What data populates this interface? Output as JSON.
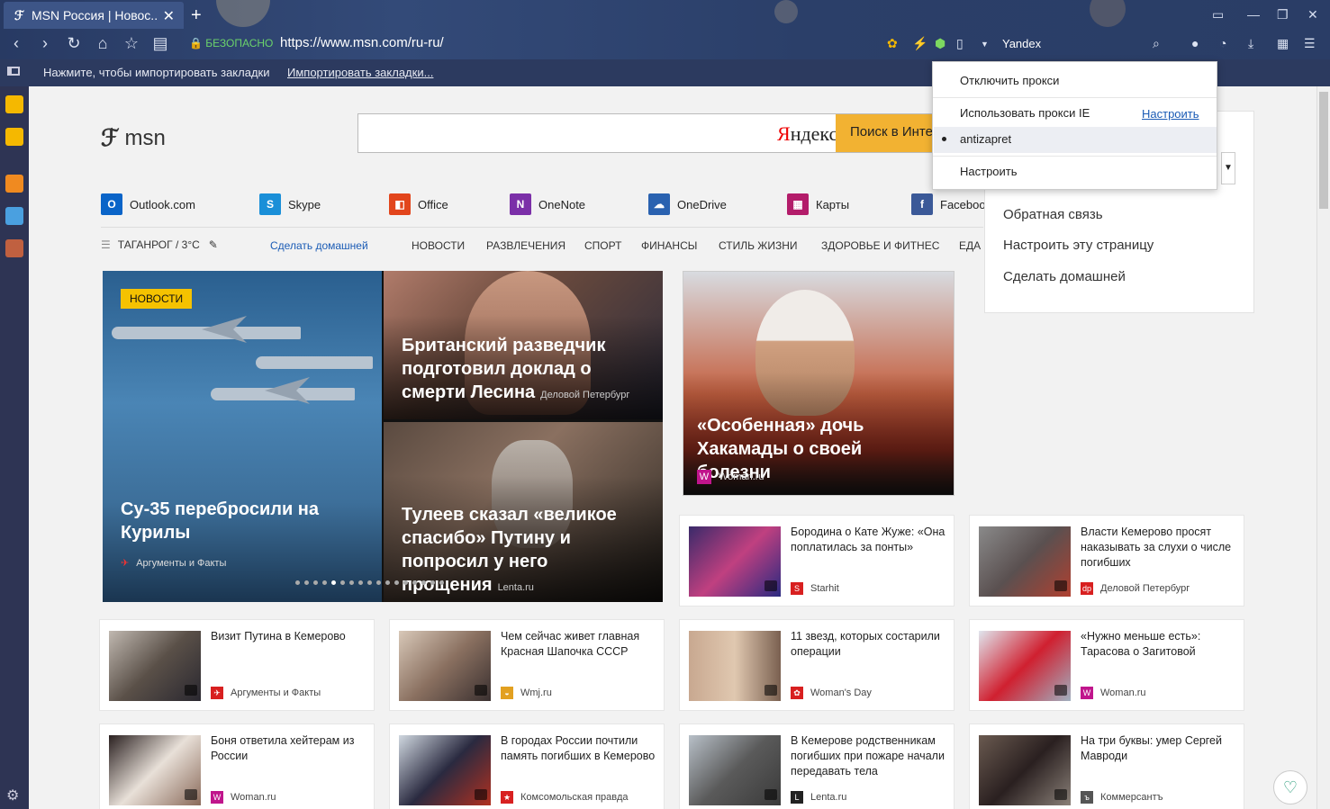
{
  "browser": {
    "tab_title": "MSN Россия | Новос...",
    "tab_close": "✕",
    "new_tab": "+",
    "secure_label": "БЕЗОПАСНО",
    "url": "https://www.msn.com/ru-ru/",
    "search_engine": "Yandex",
    "bookmark_message": "Нажмите, чтобы импортировать закладки",
    "bookmark_import_link": "Импортировать закладки..."
  },
  "proxy_menu": {
    "disable": "Отключить прокси",
    "use_ie": "Использовать прокси IE",
    "configure_link": "Настроить",
    "selected_proxy": "antizapret",
    "configure": "Настроить"
  },
  "msn": {
    "logo": "msn",
    "yandex_brand_first": "Я",
    "yandex_brand_rest": "ндекс",
    "search_button": "Поиск в Инте",
    "apps": [
      {
        "label": "Outlook.com",
        "color": "#0a64c8",
        "glyph": "O"
      },
      {
        "label": "Skype",
        "color": "#1a8fd8",
        "glyph": "S"
      },
      {
        "label": "Office",
        "color": "#e2451c",
        "glyph": "◧"
      },
      {
        "label": "OneNote",
        "color": "#7b2fa8",
        "glyph": "N"
      },
      {
        "label": "OneDrive",
        "color": "#2a62b0",
        "glyph": "☁"
      },
      {
        "label": "Карты",
        "color": "#b31c6a",
        "glyph": "▦"
      },
      {
        "label": "Faceboo",
        "color": "#3b5998",
        "glyph": "f"
      }
    ],
    "weather": "ТАГАНРОГ / 3°C",
    "make_home": "Сделать домашней",
    "categories": [
      "НОВОСТИ",
      "РАЗВЛЕЧЕНИЯ",
      "СПОРТ",
      "ФИНАНСЫ",
      "СТИЛЬ ЖИЗНИ",
      "ЗДОРОВЬЕ И ФИТНЕС",
      "ЕДА"
    ],
    "settings_panel": {
      "items": [
        "Обратная связь",
        "Настроить эту страницу",
        "Сделать домашней"
      ],
      "select_arrow": "▼"
    }
  },
  "hero": {
    "badge": "НОВОСТИ",
    "main_title": "Су-35 перебросили на Курилы",
    "main_source": "Аргументы и Факты",
    "top_right_title": "Британский разведчик подготовил доклад о смерти Лесина",
    "top_right_source": "Деловой Петербург",
    "bottom_right_title": "Тулеев сказал «великое спасибо» Путину и попросил у него прощения",
    "bottom_right_source": "Lenta.ru",
    "side_title": "«Особенная» дочь Хакамады о своей болезни",
    "side_source": "Woman.ru",
    "side_source_icon": "W",
    "dots_total": 17,
    "dots_active": 5
  },
  "cards": [
    {
      "title": "Бородина о Кате Жуже: «Она поплатилась за понты»",
      "source": "Starhit",
      "icon": "S",
      "icon_color": "#d82020",
      "thumb": "linear-gradient(135deg,#3a2a6a,#c04080,#2a2a80)"
    },
    {
      "title": "Власти Кемерово просят наказывать за слухи о числе погибших",
      "source": "Деловой Петербург",
      "icon": "dp",
      "icon_color": "#d82020",
      "thumb": "linear-gradient(135deg,#8a8a8a,#5a5050,#b04030)"
    },
    {
      "title": "Визит Путина в Кемерово",
      "source": "Аргументы и Факты",
      "icon": "✈",
      "icon_color": "#d82020",
      "thumb": "linear-gradient(135deg,#c0b8b0,#5a5048,#2a2830)"
    },
    {
      "title": "Чем сейчас живет главная Красная Шапочка СССР",
      "source": "Wmj.ru",
      "icon": "◒",
      "icon_color": "#e2a020",
      "thumb": "linear-gradient(135deg,#d8c8b8,#8a7060,#3a3030)"
    },
    {
      "title": "11 звезд, которых состарили операции",
      "source": "Woman's Day",
      "icon": "✿",
      "icon_color": "#d82020",
      "thumb": "linear-gradient(90deg,#c8a890,#e0c8b0,#7a6050)"
    },
    {
      "title": "«Нужно меньше есть»: Тарасова о Загитовой",
      "source": "Woman.ru",
      "icon": "W",
      "icon_color": "#c0158c",
      "thumb": "linear-gradient(135deg,#e0e6ee,#d02030,#a0b0c0)"
    },
    {
      "title": "Боня ответила хейтерам из России",
      "source": "Woman.ru",
      "icon": "W",
      "icon_color": "#c0158c",
      "thumb": "linear-gradient(135deg,#2a2020,#e8e0d8,#8a6a5a)"
    },
    {
      "title": "В городах России почтили память погибших в Кемерово",
      "source": "Комсомольская правда",
      "icon": "★",
      "icon_color": "#d82020",
      "thumb": "linear-gradient(135deg,#d0d8e0,#2a2a40,#b03020)"
    },
    {
      "title": "В Кемерове родственникам погибших при пожаре начали передавать тела",
      "source": "Lenta.ru",
      "icon": "L",
      "icon_color": "#222222",
      "thumb": "linear-gradient(135deg,#b8c0c8,#5a5a5a,#3a3a3a)"
    },
    {
      "title": "На три буквы: умер Сергей Мавроди",
      "source": "Коммерсантъ",
      "icon": "ъ",
      "icon_color": "#555555",
      "thumb": "linear-gradient(135deg,#6a5a50,#2a2020,#8a8078)"
    }
  ],
  "colors": {
    "accent": "#f2b232",
    "link": "#1a5bb5",
    "browser_bg": "#2c3a5f"
  }
}
